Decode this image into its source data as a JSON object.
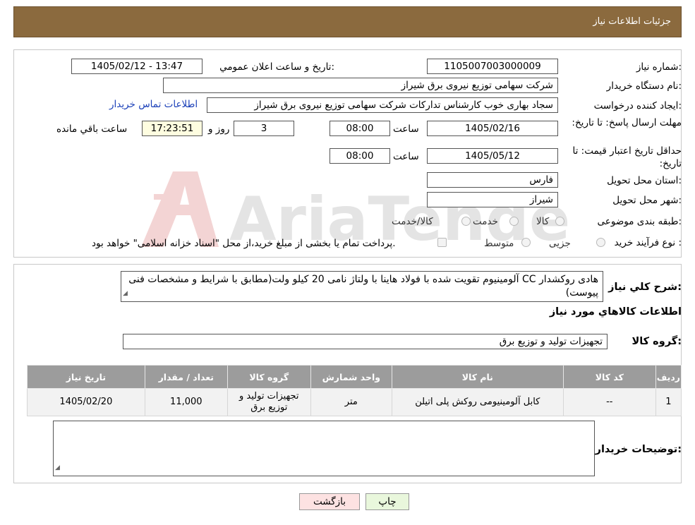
{
  "header": {
    "title": "جزئیات اطلاعات نیاز"
  },
  "form": {
    "need_number_label": "شماره نیاز:",
    "need_number": "1105007003000009",
    "announce_label": "تاریخ و ساعت اعلان عمومي:",
    "announce_value": "1405/02/12 - 13:47",
    "buyer_org_label": "نام دستگاه خریدار:",
    "buyer_org": "شرکت سهامی توزیع نیروی برق شیراز",
    "requester_label": "ایجاد کننده درخواست:",
    "requester": "سجاد بهاری خوب کارشناس تدارکات شرکت سهامی توزیع نیروی برق شیراز",
    "contact_link": "اطلاعات تماس خریدار",
    "reply_deadline_label": "مهلت ارسال پاسخ: تا تاریخ:",
    "reply_date": "1405/02/16",
    "time_label": "ساعت",
    "reply_time": "08:00",
    "days_value": "3",
    "days_label": "روز و",
    "remaining_time": "17:23:51",
    "remaining_label": "ساعت باقي مانده",
    "price_validity_label": "حداقل تاریخ اعتبار قیمت: تا تاریخ:",
    "price_date": "1405/05/12",
    "price_time": "08:00",
    "province_label": "استان محل تحویل:",
    "province": "فارس",
    "city_label": "شهر محل تحویل:",
    "city": "شیراز",
    "category_label": "طبقه بندی موضوعی:",
    "category_options": [
      "کالا",
      "خدمت",
      "کالا/خدمت"
    ],
    "process_label": "نوع فرآیند خرید :",
    "process_options": [
      "جزیی",
      "متوسط"
    ],
    "process_note": "پرداخت تمام یا بخشی از مبلغ خرید،از محل \"اسناد خزانه اسلامی\" خواهد بود."
  },
  "summary": {
    "label": "شرح کلي نياز:",
    "text": "هادی روکشدار CC آلومینیوم تقویت شده با فولاد هاینا با ولتاژ نامی 20 کیلو ولت(مطابق با شرایط و مشخصات فنی پیوست)",
    "goods_info_title": "اطلاعات کالاهاي مورد نياز",
    "goods_group_label": "گروه کالا:",
    "goods_group": "تجهیزات تولید و توزیع برق"
  },
  "table": {
    "headers": [
      "رديف",
      "کد کالا",
      "نام کالا",
      "واحد شمارش",
      "گروه کالا",
      "تعداد / مقدار",
      "تاریخ نیاز"
    ],
    "rows": [
      [
        "1",
        "--",
        "کابل آلومینیومی روکش پلی اتیلن",
        "متر",
        "تجهیزات تولید و توزیع برق",
        "11,000",
        "1405/02/20"
      ]
    ]
  },
  "buyer_notes": {
    "label": "توضیحات خریدار:",
    "value": ""
  },
  "buttons": {
    "print": "چاپ",
    "back": "بازگشت"
  },
  "watermark": {
    "text": "AriaTender.neT"
  },
  "colors": {
    "header_bg": "#8b6a3e",
    "link": "#1a3fb8",
    "table_header": "#9c9c9c",
    "back_button": "#fde2e2",
    "print_button": "#e9f7dc"
  }
}
